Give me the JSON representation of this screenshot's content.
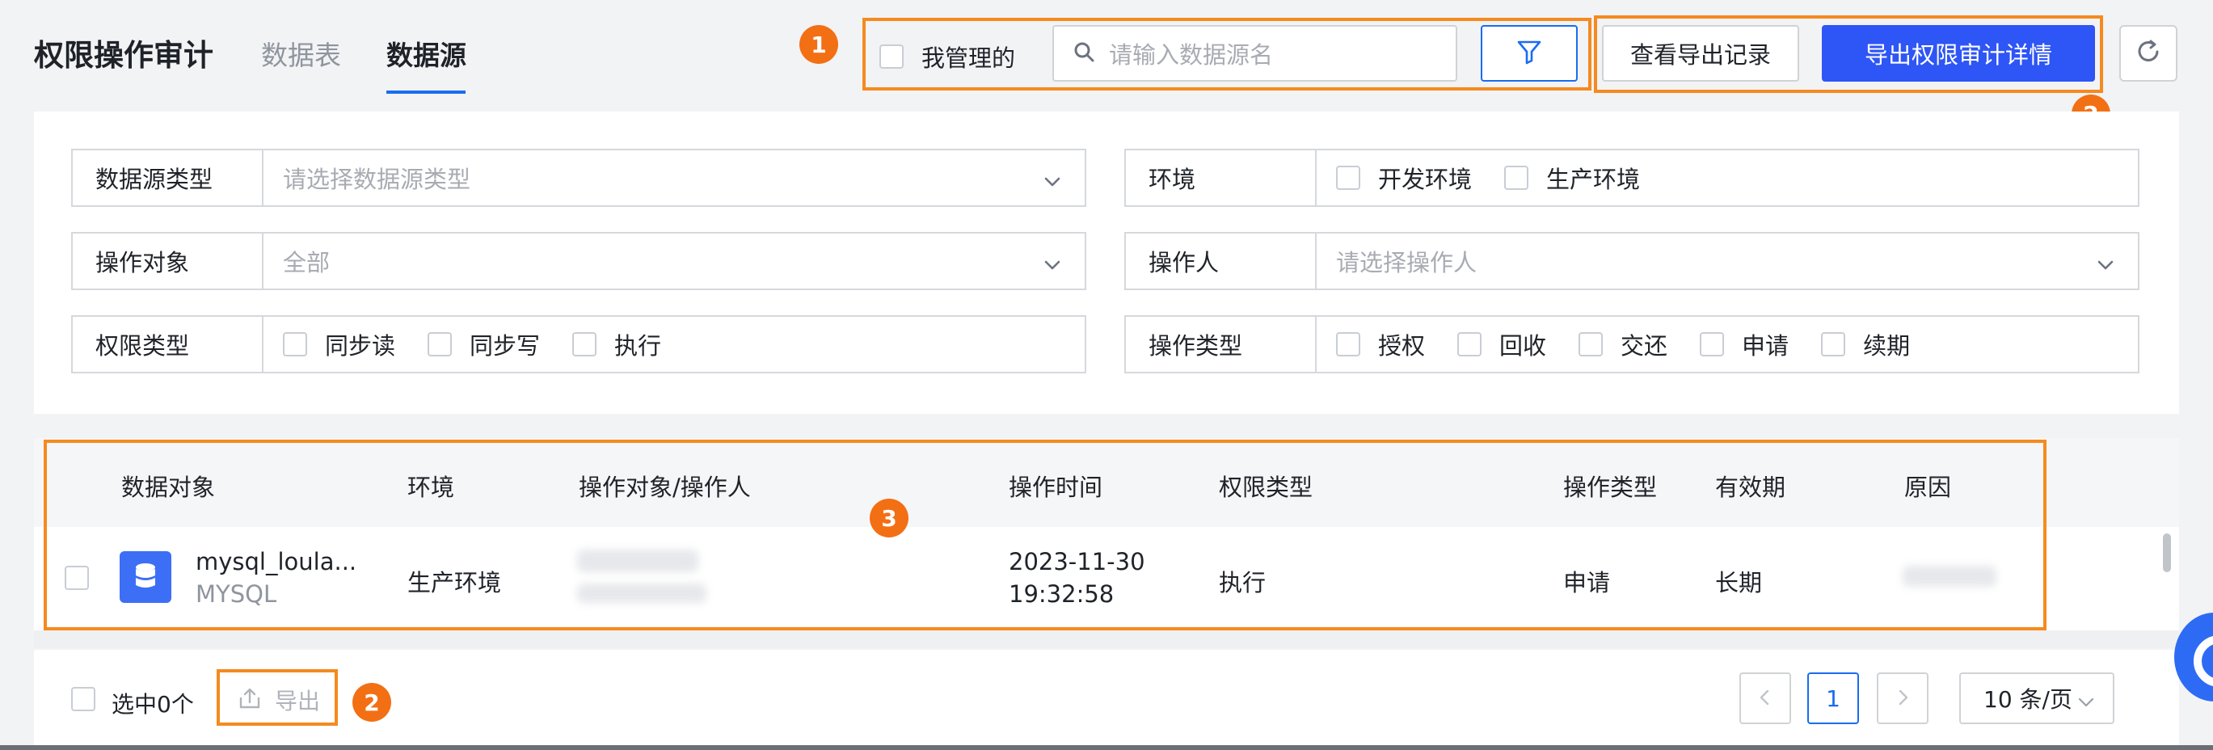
{
  "header": {
    "title": "权限操作审计",
    "tabs": [
      {
        "label": "数据表"
      },
      {
        "label": "数据源"
      }
    ],
    "my_managed_label": "我管理的",
    "search_placeholder": "请输入数据源名",
    "view_export_records": "查看导出记录",
    "export_details": "导出权限审计详情"
  },
  "annotations": {
    "badge_1": "1",
    "badge_2": "2",
    "badge_3": "3",
    "badge_2b": "2",
    "color": "#f58a1f"
  },
  "filters": {
    "datasource_type": {
      "label": "数据源类型",
      "placeholder": "请选择数据源类型"
    },
    "environment": {
      "label": "环境",
      "options": [
        "开发环境",
        "生产环境"
      ]
    },
    "operation_object": {
      "label": "操作对象",
      "value": "全部"
    },
    "operator": {
      "label": "操作人",
      "placeholder": "请选择操作人"
    },
    "permission_type": {
      "label": "权限类型",
      "options": [
        "同步读",
        "同步写",
        "执行"
      ]
    },
    "operation_type": {
      "label": "操作类型",
      "options": [
        "授权",
        "回收",
        "交还",
        "申请",
        "续期"
      ]
    }
  },
  "table": {
    "columns": [
      "数据对象",
      "环境",
      "操作对象/操作人",
      "操作时间",
      "权限类型",
      "操作类型",
      "有效期",
      "原因"
    ],
    "rows": [
      {
        "object_name": "mysql_loula...",
        "object_type": "MYSQL",
        "environment": "生产环境",
        "time_date": "2023-11-30",
        "time_clock": "19:32:58",
        "permission_type": "执行",
        "operation_type": "申请",
        "validity": "长期"
      }
    ]
  },
  "footer": {
    "selected_label": "选中0个",
    "export_label": "导出",
    "current_page": "1",
    "page_size": "10 条/页"
  },
  "colors": {
    "primary": "#2e55f5",
    "accent": "#1a6cf0",
    "annotation": "#f58a1f",
    "badge": "#f36f14"
  }
}
